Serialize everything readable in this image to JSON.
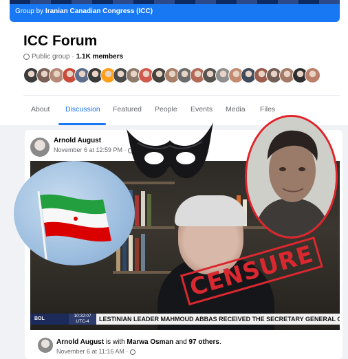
{
  "banner": {
    "prefix": "Group by",
    "org": "Iranian Canadian Congress (ICC)"
  },
  "group": {
    "name": "ICC Forum",
    "privacy": "Public group ·",
    "members": "1.1K members"
  },
  "member_avatars": [
    "#3c3c3c",
    "#7a6155",
    "#b58a76",
    "#c94b3b",
    "#5d6f8a",
    "#3a3a3a",
    "#ff9f1a",
    "#4b4b4b",
    "#8e7b6c",
    "#d2594d",
    "#46423e",
    "#a87f68",
    "#6c6c6c",
    "#b36b58",
    "#57534e",
    "#8f8f8f",
    "#c38b70",
    "#3f4a5a",
    "#9b5d4e",
    "#745f56",
    "#a57a66",
    "#2f2f2f",
    "#bb7f6a"
  ],
  "tabs": [
    "About",
    "Discussion",
    "Featured",
    "People",
    "Events",
    "Media",
    "Files"
  ],
  "active_tab": "Discussion",
  "post": {
    "author": "Arnold August",
    "time": "November 6 at 12:59 PM ·",
    "ticker": {
      "channel": "BOL",
      "clock_time": "10:32:07",
      "clock_zone": "UTC-4",
      "headline": "LESTINIAN LEADER MAHMOUD ABBAS RECEIVED THE SECRETARY GENERAL OF TH"
    },
    "stamp": "CENSURE"
  },
  "shared": {
    "author": "Arnold August",
    "with_text": "is with",
    "with_name": "Marwa Osman",
    "and_text": "and",
    "others": "97 others",
    "time": "November 6 at 11:16 AM ·"
  },
  "colors": {
    "brand_blue": "#1877f2",
    "stamp_red": "#d9282f",
    "portrait_ring": "#e1222a"
  }
}
